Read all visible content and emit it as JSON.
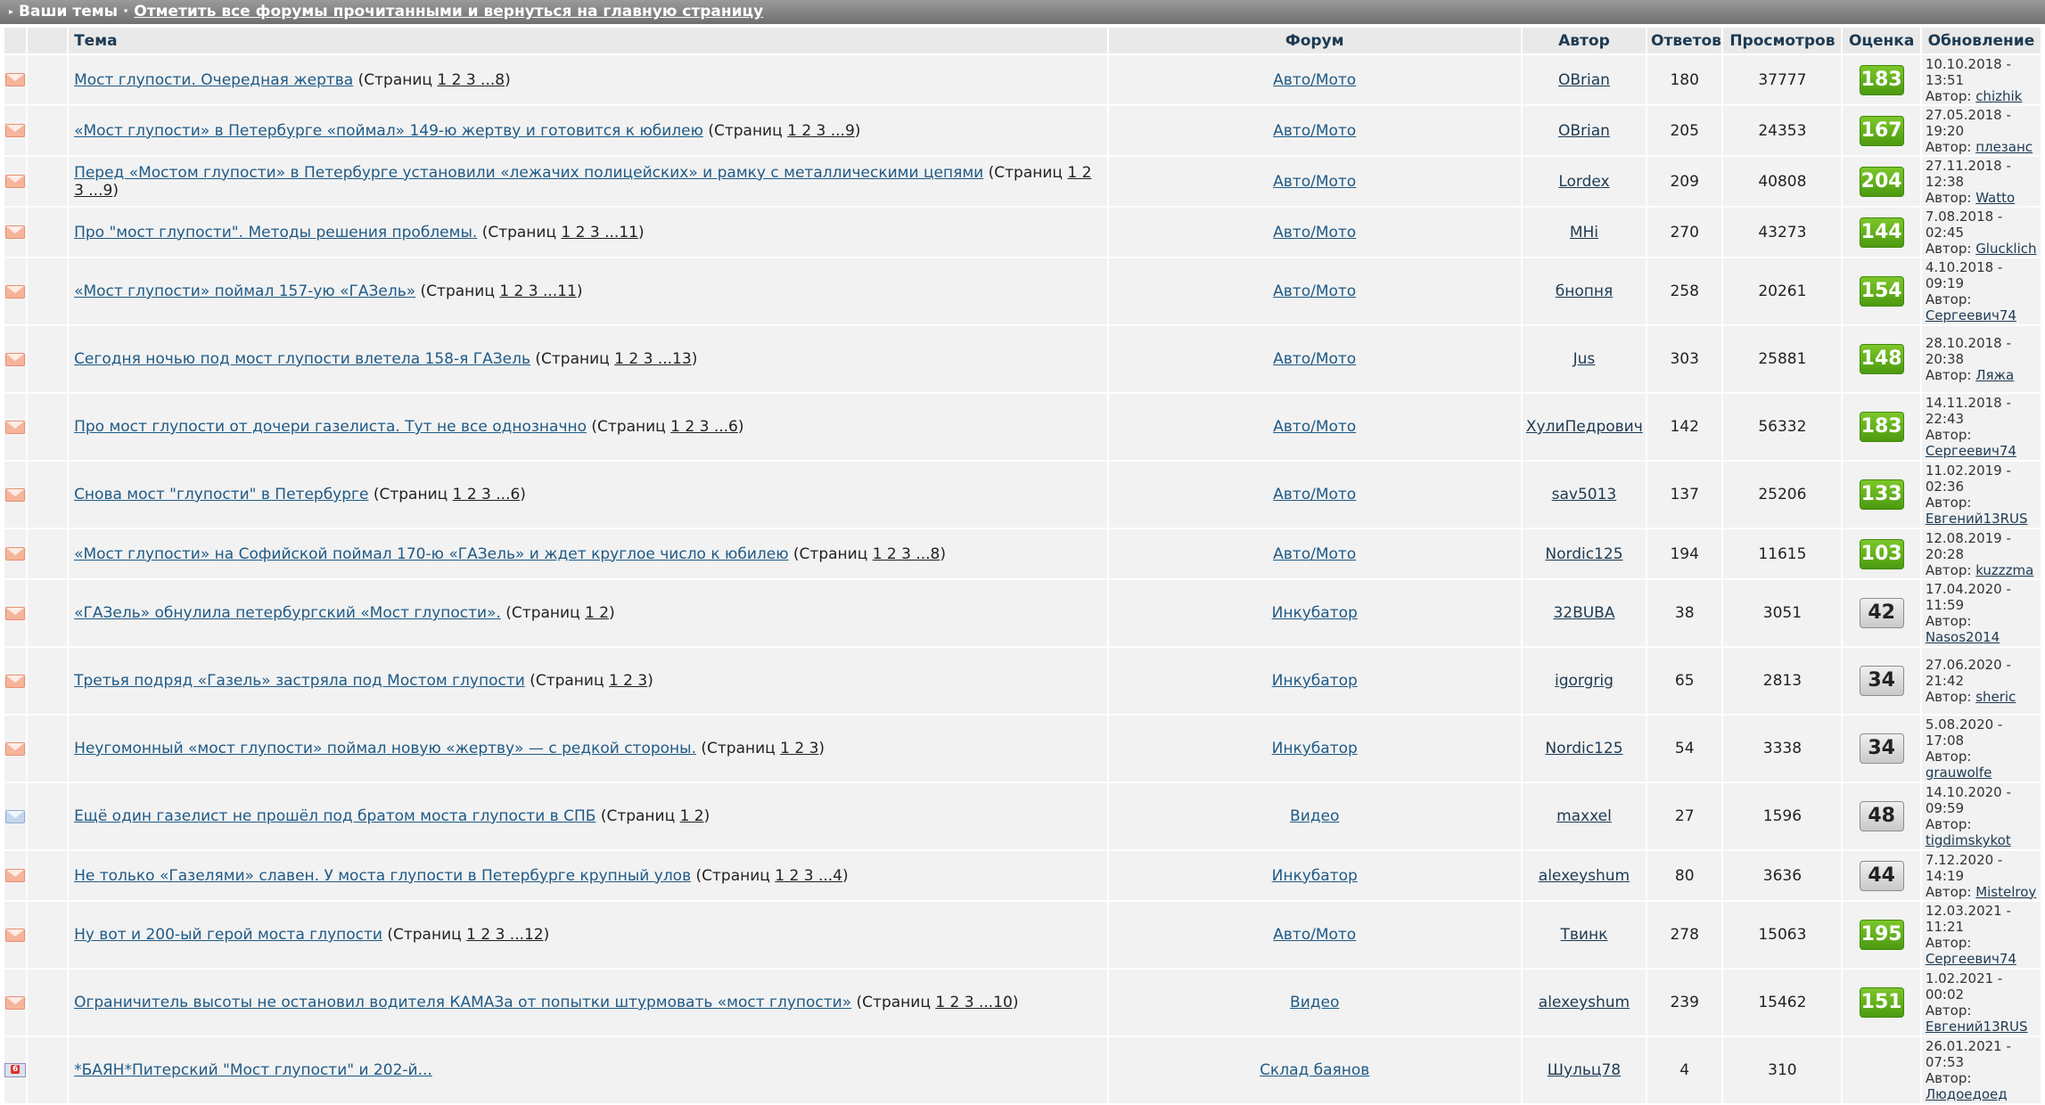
{
  "topbar": {
    "label": "Ваши темы",
    "separator": " · ",
    "link": "Отметить все форумы прочитанными и вернуться на главную страницу"
  },
  "columns": {
    "topic": "Тема",
    "forum": "Форум",
    "author": "Автор",
    "replies": "Ответов",
    "views": "Просмотров",
    "rating": "Оценка",
    "updated": "Обновление"
  },
  "colors": {
    "rating_green": "#5aac16",
    "rating_gray": "#d9d9d9",
    "link": "#1f5a86"
  },
  "labels": {
    "pages_prefix": "(Страниц ",
    "pages_suffix": ")",
    "author_prefix": "Автор: "
  },
  "rows": [
    {
      "icon": "envelope-icon",
      "title": "Мост глупости. Очередная жертва",
      "pages": "1 2 3 ...8",
      "forum": "Авто/Мото",
      "author": "OBrian",
      "replies": "180",
      "views": "37777",
      "rating": "183",
      "rating_style": "green",
      "upd_date": "10.10.2018 - 13:51",
      "upd_author": "chizhik"
    },
    {
      "icon": "envelope-icon",
      "title": "«Мост глупости» в Петербурге «поймал» 149-ю жертву и готовится к юбилею",
      "pages": "1 2 3 ...9",
      "forum": "Авто/Мото",
      "author": "OBrian",
      "replies": "205",
      "views": "24353",
      "rating": "167",
      "rating_style": "green",
      "upd_date": "27.05.2018 - 19:20",
      "upd_author": "плезанс"
    },
    {
      "icon": "envelope-icon",
      "title": "Перед «Мостом глупости» в Петербурге установили «лежачих полицейских» и рамку с металлическими цепями",
      "pages": "1 2 3 ...9",
      "forum": "Авто/Мото",
      "author": "Lordex",
      "replies": "209",
      "views": "40808",
      "rating": "204",
      "rating_style": "green",
      "upd_date": "27.11.2018 - 12:38",
      "upd_author": "Watto"
    },
    {
      "icon": "envelope-icon",
      "title": "Про \"мост глупости\". Методы решения проблемы.",
      "pages": "1 2 3 ...11",
      "forum": "Авто/Мото",
      "author": "MHi",
      "replies": "270",
      "views": "43273",
      "rating": "144",
      "rating_style": "green",
      "upd_date": "7.08.2018 - 02:45",
      "upd_author": "Glucklich"
    },
    {
      "icon": "envelope-icon",
      "title": "«Мост глупости» поймал 157-ую «ГАЗель»",
      "pages": "1 2 3 ...11",
      "forum": "Авто/Мото",
      "author": "бнопня",
      "replies": "258",
      "views": "20261",
      "rating": "154",
      "rating_style": "green",
      "upd_date": "4.10.2018 - 09:19",
      "upd_author": "Сергеевич74"
    },
    {
      "icon": "envelope-icon",
      "title": "Сегодня ночью под мост глупости влетела 158-я ГАЗель",
      "pages": "1 2 3 ...13",
      "forum": "Авто/Мото",
      "author": "Jus",
      "replies": "303",
      "views": "25881",
      "rating": "148",
      "rating_style": "green",
      "upd_date": "28.10.2018 - 20:38",
      "upd_author": "Ляжа"
    },
    {
      "icon": "envelope-icon",
      "title": "Про мост глупости от дочери газелиста. Тут не все однозначно",
      "pages": "1 2 3 ...6",
      "forum": "Авто/Мото",
      "author": "ХулиПедрович",
      "replies": "142",
      "views": "56332",
      "rating": "183",
      "rating_style": "green",
      "upd_date": "14.11.2018 - 22:43",
      "upd_author": "Сергеевич74"
    },
    {
      "icon": "envelope-icon",
      "title": "Снова мост \"глупости\" в Петербурге",
      "pages": "1 2 3 ...6",
      "forum": "Авто/Мото",
      "author": "sav5013",
      "replies": "137",
      "views": "25206",
      "rating": "133",
      "rating_style": "green",
      "upd_date": "11.02.2019 - 02:36",
      "upd_author": "Евгений13RUS"
    },
    {
      "icon": "envelope-icon",
      "title": "«Мост глупости» на Софийской поймал 170-ю «ГАЗель» и ждет круглое число к юбилею",
      "pages": "1 2 3 ...8",
      "forum": "Авто/Мото",
      "author": "Nordic125",
      "replies": "194",
      "views": "11615",
      "rating": "103",
      "rating_style": "green",
      "upd_date": "12.08.2019 - 20:28",
      "upd_author": "kuzzzma"
    },
    {
      "icon": "envelope-icon",
      "title": "«ГАЗель» обнулила петербургский «Мост глупости».",
      "pages": "1 2",
      "forum": "Инкубатор",
      "author": "32BUBA",
      "replies": "38",
      "views": "3051",
      "rating": "42",
      "rating_style": "gray",
      "upd_date": "17.04.2020 - 11:59",
      "upd_author": "Nasos2014"
    },
    {
      "icon": "envelope-icon",
      "title": "Третья подряд «Газель» застряла под Мостом глупости",
      "pages": "1 2 3",
      "forum": "Инкубатор",
      "author": "igorgrig",
      "replies": "65",
      "views": "2813",
      "rating": "34",
      "rating_style": "gray",
      "upd_date": "27.06.2020 - 21:42",
      "upd_author": "sheric"
    },
    {
      "icon": "envelope-icon",
      "title": "Неугомонный «мост глупости» поймал новую «жертву» — с редкой стороны.",
      "pages": "1 2 3",
      "forum": "Инкубатор",
      "author": "Nordic125",
      "replies": "54",
      "views": "3338",
      "rating": "34",
      "rating_style": "gray",
      "upd_date": "5.08.2020 - 17:08",
      "upd_author": "grauwolfe"
    },
    {
      "icon": "envelope-blue-icon",
      "title": "Ещё один газелист не прошёл под братом моста глупости в СПБ",
      "pages": "1 2",
      "forum": "Видео",
      "author": "maxxel",
      "replies": "27",
      "views": "1596",
      "rating": "48",
      "rating_style": "gray",
      "upd_date": "14.10.2020 - 09:59",
      "upd_author": "tigdimskykot"
    },
    {
      "icon": "envelope-icon",
      "title": "Не только «Газелями» славен. У моста глупости в Петербурге крупный улов",
      "pages": "1 2 3 ...4",
      "forum": "Инкубатор",
      "author": "alexeyshum",
      "replies": "80",
      "views": "3636",
      "rating": "44",
      "rating_style": "gray",
      "upd_date": "7.12.2020 - 14:19",
      "upd_author": "Mistelroy"
    },
    {
      "icon": "envelope-icon",
      "title": "Ну вот и 200-ый герой моста глупости",
      "pages": "1 2 3 ...12",
      "forum": "Авто/Мото",
      "author": "Твинк",
      "replies": "278",
      "views": "15063",
      "rating": "195",
      "rating_style": "green",
      "upd_date": "12.03.2021 - 11:21",
      "upd_author": "Сергеевич74"
    },
    {
      "icon": "envelope-icon",
      "title": "Ограничитель высоты не остановил водителя КАМАЗа от попытки штурмовать «мост глупости»",
      "pages": "1 2 3 ...10",
      "forum": "Видео",
      "author": "alexeyshum",
      "replies": "239",
      "views": "15462",
      "rating": "151",
      "rating_style": "green",
      "upd_date": "1.02.2021 - 00:02",
      "upd_author": "Евгений13RUS"
    },
    {
      "icon": "new-post-icon",
      "icon_text": "6",
      "title": "*БАЯН*Питерский \"Мост глупости\" и 202-й...",
      "pages": "",
      "forum": "Склад баянов",
      "author": "Шульц78",
      "replies": "4",
      "views": "310",
      "rating": "",
      "rating_style": "none",
      "upd_date": "26.01.2021 - 07:53",
      "upd_author": "Людоедоед"
    }
  ]
}
